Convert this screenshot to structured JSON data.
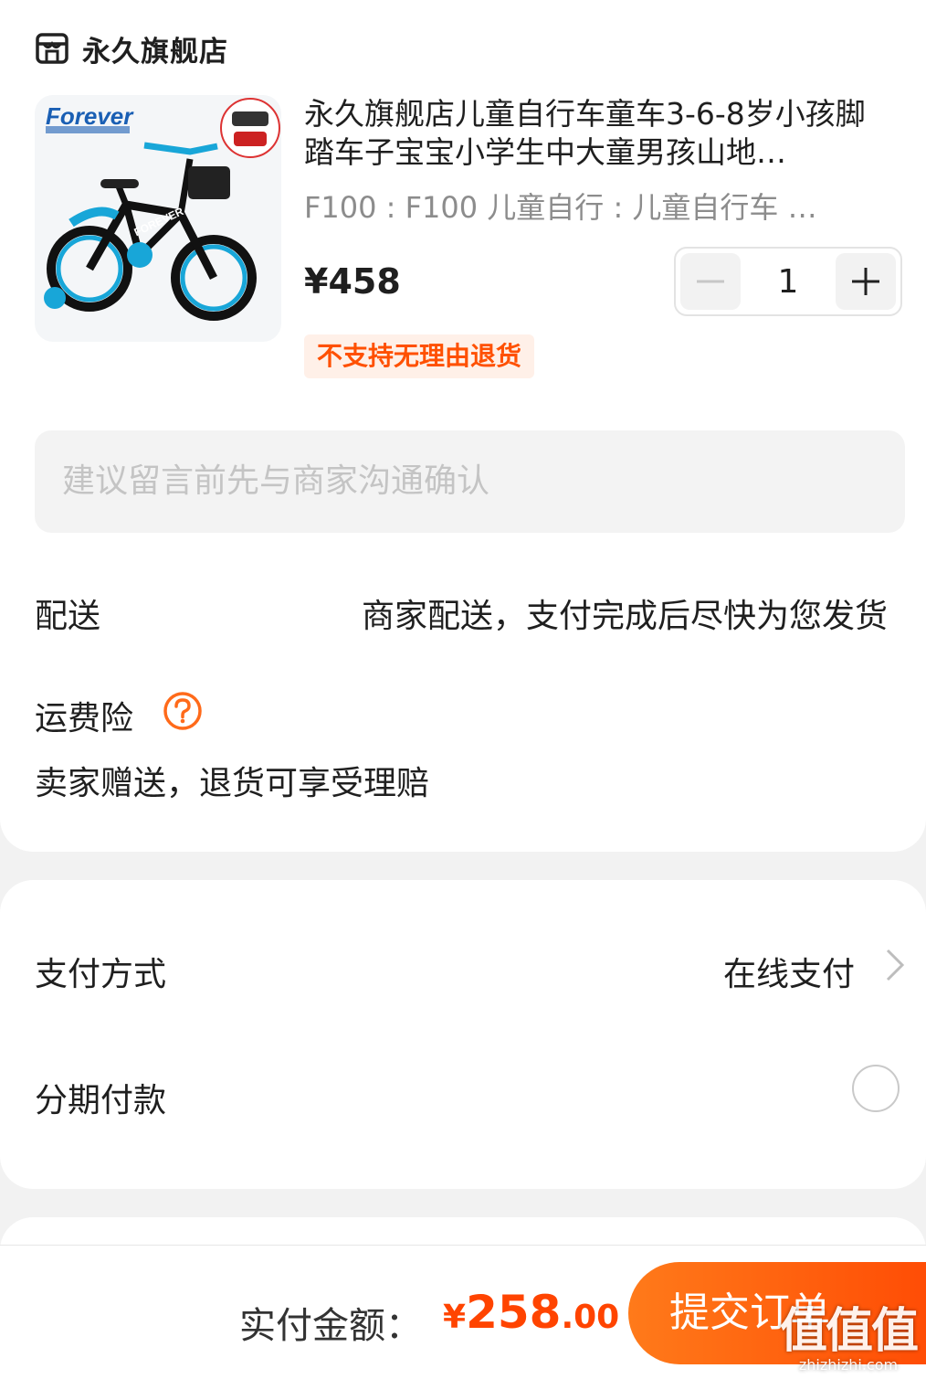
{
  "shop": {
    "name": "永久旗舰店",
    "icon": "store-icon"
  },
  "product": {
    "brand_logo_text": "Forever",
    "title": "永久旗舰店儿童自行车童车3-6-8岁小孩脚踏车子宝宝小学生中大童男孩山地…",
    "spec": "F100 : F100  儿童自行 : 儿童自行车  …",
    "price": "¥458",
    "quantity": "1",
    "tag": "不支持无理由退货"
  },
  "remark": {
    "placeholder": "建议留言前先与商家沟通确认"
  },
  "delivery": {
    "label": "配送",
    "value": "商家配送，支付完成后尽快为您发货"
  },
  "insurance": {
    "label": "运费险",
    "desc": "卖家赠送，退货可享受理赔",
    "icon": "question-circle-icon"
  },
  "payment": {
    "method_label": "支付方式",
    "method_value": "在线支付",
    "installment_label": "分期付款",
    "installment_checked": false
  },
  "footer": {
    "total_label": "实付金额：",
    "currency": "¥",
    "amount_int": "258",
    "amount_dec": ".00",
    "submit_label": "提交订单"
  },
  "watermark": {
    "logo": "值值值",
    "url": "zhizhizhi.com"
  },
  "colors": {
    "accent": "#ff5000",
    "price_red": "#ff4400",
    "tag_bg": "#fff0e8",
    "background": "#f2f2f2"
  }
}
